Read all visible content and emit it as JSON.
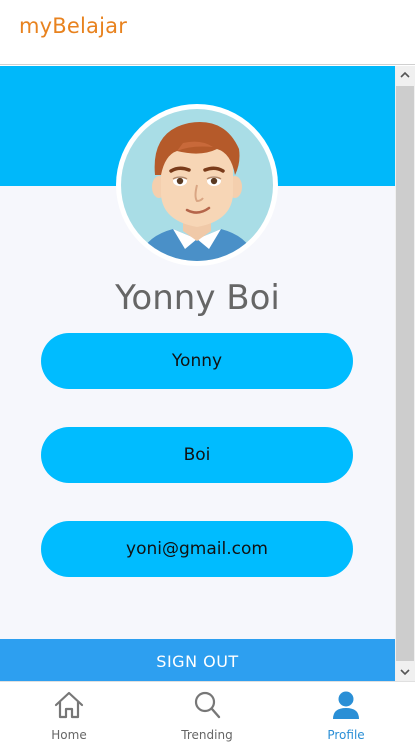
{
  "app": {
    "title": "myBelajar"
  },
  "profile": {
    "display_name": "Yonny Boi",
    "first_name": "Yonny",
    "last_name": "Boi",
    "email": "yoni@gmail.com",
    "sign_out_label": "SIGN OUT"
  },
  "nav": {
    "items": [
      {
        "label": "Home",
        "icon": "home-icon",
        "active": false
      },
      {
        "label": "Trending",
        "icon": "search-icon",
        "active": false
      },
      {
        "label": "Profile",
        "icon": "person-icon",
        "active": true
      }
    ]
  },
  "colors": {
    "brand": "#e8821e",
    "banner": "#00b8fa",
    "field": "#00bcff",
    "signout": "#2d9ff0",
    "active_nav": "#2a8fd6"
  }
}
